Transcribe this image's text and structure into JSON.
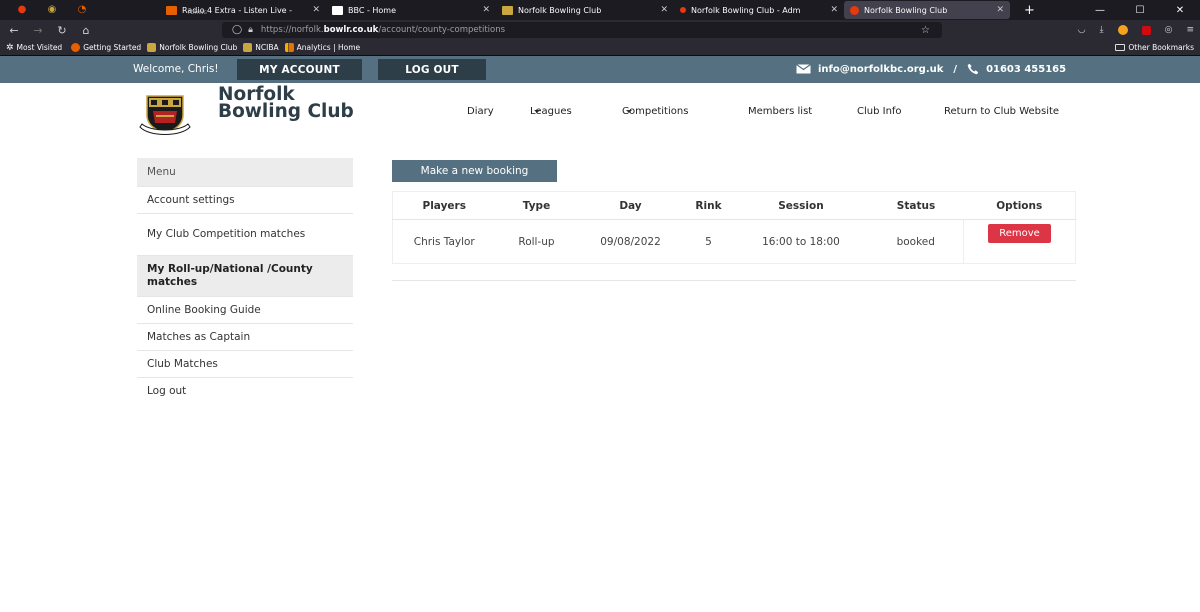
{
  "browser": {
    "tabs": [
      {
        "label": "Radio 4 Extra - Listen Live - ",
        "sub": "PLAYING",
        "fav_color": "#e66000",
        "active": false
      },
      {
        "label": "BBC - Home",
        "sub": "",
        "fav_color": "#ffffff",
        "active": false
      },
      {
        "label": "Norfolk Bowling Club",
        "sub": "",
        "fav_color": "#c9a640",
        "active": false
      },
      {
        "label": "Norfolk Bowling Club - Adm",
        "sub": "",
        "fav_color": "#e8380d",
        "active": false
      },
      {
        "label": "Norfolk Bowling Club",
        "sub": "",
        "fav_color": "#e8380d",
        "active": true
      }
    ],
    "url_prefix": "https://norfolk.",
    "url_domain": "bowlr.co.uk",
    "url_path": "/account/county-competitions",
    "bookmarks": [
      {
        "label": "Most Visited",
        "color": "#d0d0d8"
      },
      {
        "label": "Getting Started",
        "color": "#e66000"
      },
      {
        "label": "Norfolk Bowling Club",
        "color": "#c9a640"
      },
      {
        "label": "NCIBA",
        "color": "#c9a640"
      },
      {
        "label": "Analytics | Home",
        "color": "#f9ab00"
      }
    ],
    "other_bookmarks": "Other Bookmarks"
  },
  "topbar": {
    "welcome": "Welcome, Chris!",
    "my_account": "MY ACCOUNT",
    "log_out": "LOG OUT",
    "email": "info@norfolkbc.org.uk",
    "separator": "/",
    "phone": "01603 455165"
  },
  "logo": {
    "line1": "Norfolk",
    "line2": "Bowling Club"
  },
  "nav": {
    "diary": "Diary",
    "leagues": "Leagues",
    "competitions": "Competitions",
    "members": "Members list",
    "club_info": "Club Info",
    "return": "Return to Club Website"
  },
  "menu": {
    "header": "Menu",
    "items": [
      "Account settings",
      "My Club Competition matches",
      "My Roll-up/National /County matches",
      "Online Booking Guide",
      "Matches as Captain",
      "Club Matches",
      "Log out"
    ]
  },
  "new_booking": "Make a new booking",
  "table": {
    "headers": [
      "Players",
      "Type",
      "Day",
      "Rink",
      "Session",
      "Status",
      "Options"
    ],
    "rows": [
      {
        "players": "Chris Taylor",
        "type": "Roll-up",
        "day": "09/08/2022",
        "rink": "5",
        "session": "16:00 to 18:00",
        "status": "booked",
        "action": "Remove"
      }
    ]
  },
  "colors": {
    "header_bar": "#557181",
    "dark_button": "#2d3e48",
    "danger": "#dc3545"
  }
}
